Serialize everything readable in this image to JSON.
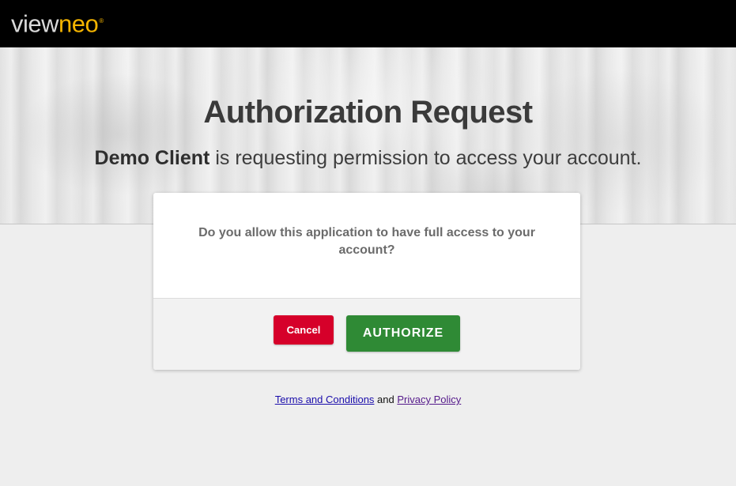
{
  "header": {
    "logo_part1": "view",
    "logo_part2": "neo",
    "logo_mark": "®"
  },
  "page": {
    "title": "Authorization Request",
    "client_name": "Demo Client",
    "subtitle_rest": " is requesting permission to access your account."
  },
  "dialog": {
    "question": "Do you allow this application to have full access to your account?",
    "cancel_label": "Cancel",
    "authorize_label": "AUTHORIZE"
  },
  "footer": {
    "terms_label": "Terms and Conditions",
    "and_text": " and ",
    "privacy_label": "Privacy Policy"
  },
  "colors": {
    "topbar": "#000000",
    "logo_accent": "#f4b400",
    "cancel": "#d6002a",
    "authorize": "#2f8a35"
  }
}
